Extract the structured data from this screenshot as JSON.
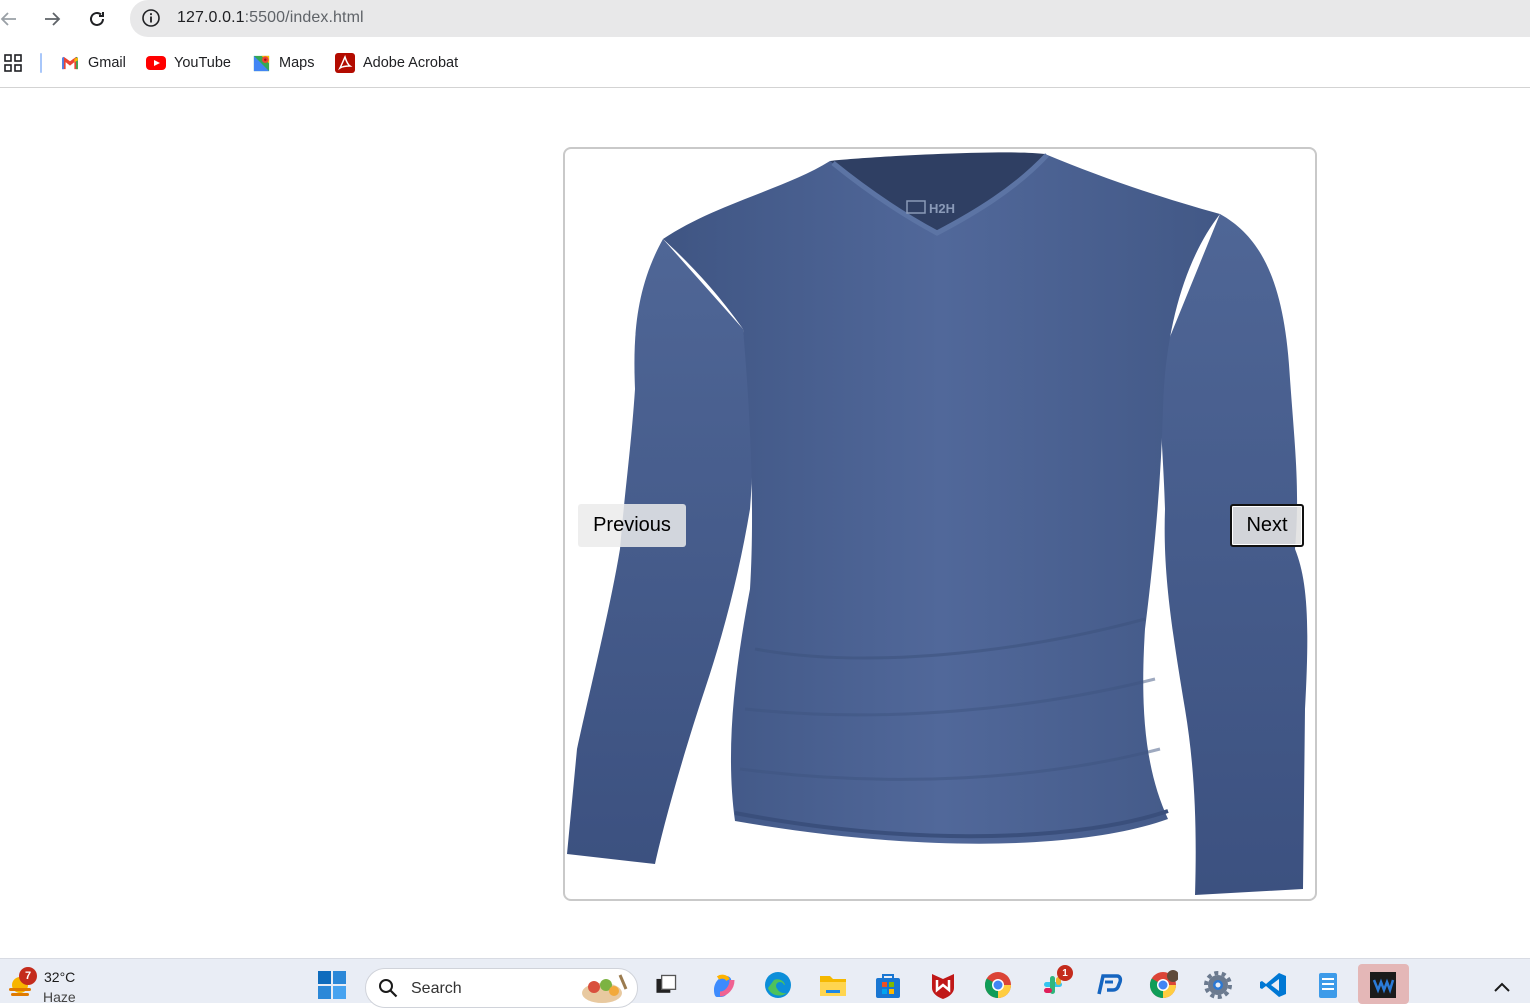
{
  "browser": {
    "url_host": "127.0.0.1",
    "url_rest": ":5500/index.html",
    "bookmarks": [
      {
        "label": "Gmail",
        "icon": "gmail-icon"
      },
      {
        "label": "YouTube",
        "icon": "youtube-icon"
      },
      {
        "label": "Maps",
        "icon": "maps-icon"
      },
      {
        "label": "Adobe Acrobat",
        "icon": "acrobat-icon"
      }
    ]
  },
  "slider": {
    "image_label": "H2H",
    "prev_label": "Previous",
    "next_label": "Next",
    "shirt_color": "#4c6390"
  },
  "taskbar": {
    "weather": {
      "badge": "7",
      "temp": "32°C",
      "condition": "Haze"
    },
    "search_placeholder": "Search",
    "apps": [
      "windows-start-icon",
      "task-view-icon",
      "copilot-icon",
      "edge-icon",
      "file-explorer-icon",
      "store-icon",
      "mcafee-icon",
      "chrome-icon",
      "slack-icon",
      "remote-desktop-icon",
      "chrome-profile-icon",
      "settings-icon",
      "vscode-icon",
      "notepad-icon",
      "waveform-app-icon"
    ],
    "slack_badge": "1"
  }
}
